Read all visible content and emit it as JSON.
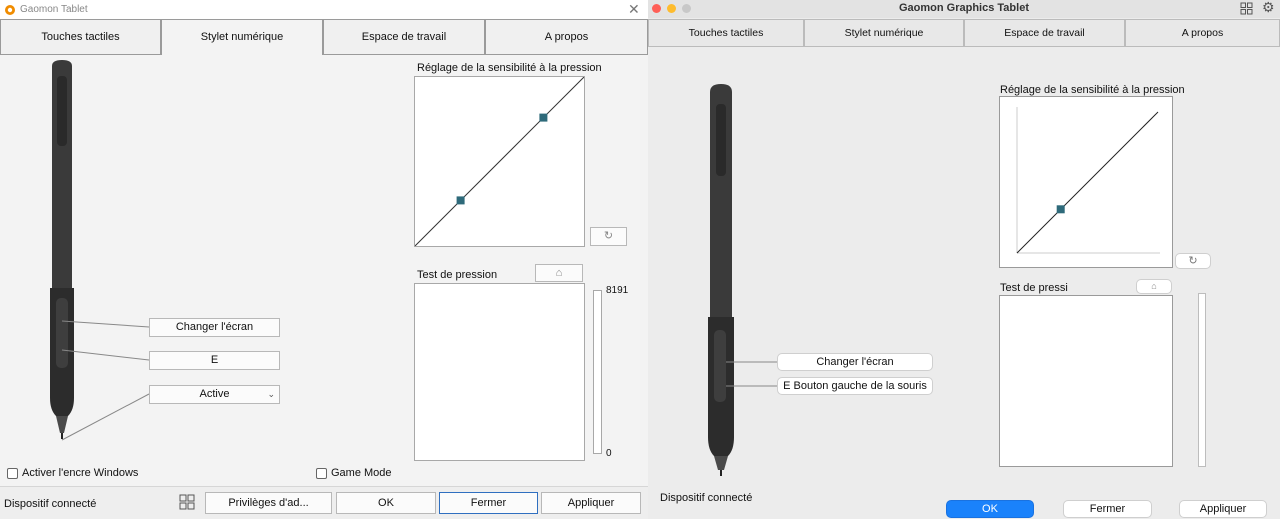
{
  "windows_app": {
    "title": "Gaomon Tablet",
    "tabs": [
      "Touches tactiles",
      "Stylet numérique",
      "Espace de travail",
      "A propos"
    ],
    "active_tab": "Stylet numérique",
    "pen_buttons": {
      "upper": "Changer l'écran",
      "lower": "E",
      "tip": "Active"
    },
    "pressure_curve": {
      "title": "Réglage de la sensibilité à la pression",
      "control_points": [
        [
          0.27,
          0.27
        ],
        [
          0.76,
          0.76
        ]
      ]
    },
    "pressure_test": {
      "title": "Test de pression",
      "max": "8191",
      "min": "0",
      "level": 0
    },
    "checkboxes": {
      "windows_ink": "Activer l'encre Windows",
      "game_mode": "Game Mode"
    },
    "status": "Dispositif connecté",
    "buttons": {
      "privileges": "Privilèges d'ad...",
      "ok": "OK",
      "close": "Fermer",
      "apply": "Appliquer"
    },
    "colors": {
      "handle": "#2e6a7a",
      "accent": "#f08c00"
    }
  },
  "mac_app": {
    "title": "Gaomon Graphics Tablet",
    "tabs": [
      "Touches tactiles",
      "Stylet numérique",
      "Espace de travail",
      "A propos"
    ],
    "pen_buttons": {
      "upper": "Changer l'écran",
      "lower": "E Bouton gauche de la souris"
    },
    "pressure_curve": {
      "title": "Réglage de la sensibilité à la pression",
      "control_points": [
        [
          0.31,
          0.31
        ]
      ]
    },
    "pressure_test": {
      "title": "Test de pressi",
      "level": 0
    },
    "status": "Dispositif connecté",
    "buttons": {
      "ok": "OK",
      "close": "Fermer",
      "apply": "Appliquer"
    },
    "colors": {
      "ok_button": "#1a82fb",
      "close_light": "#ff5f57",
      "min_light": "#febc2e",
      "zoom_light": "#c8c8c8",
      "handle": "#2e6a7a"
    }
  }
}
